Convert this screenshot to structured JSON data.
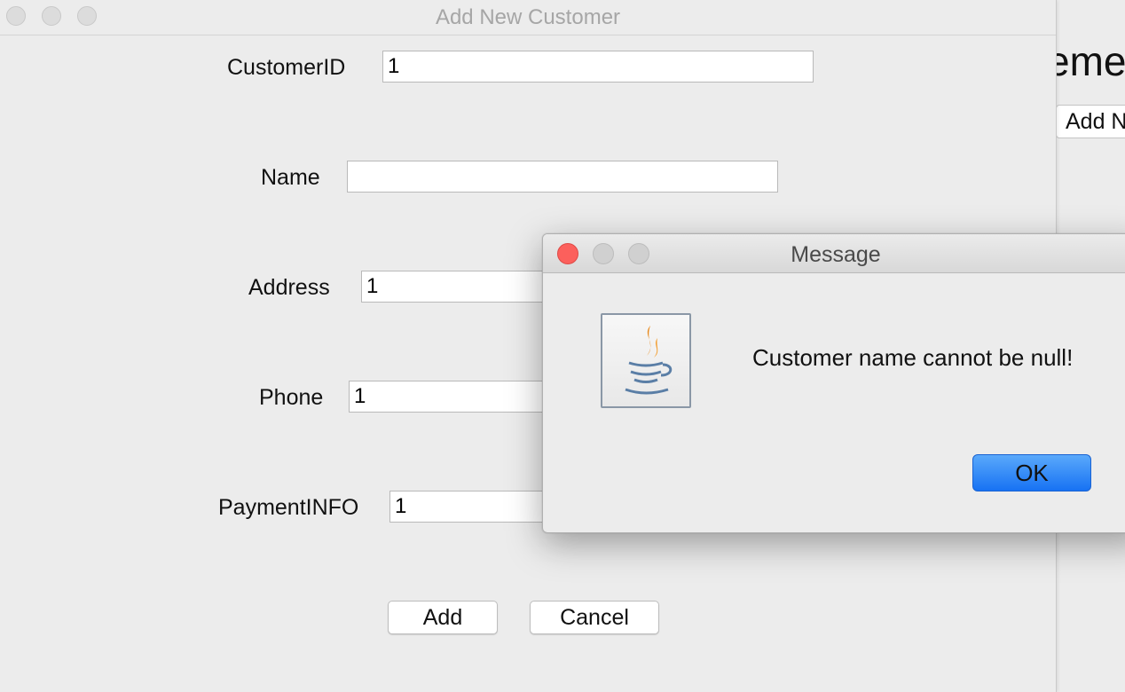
{
  "background_window": {
    "heading_fragment": "eme",
    "button_fragment": "Add N"
  },
  "add_customer_window": {
    "title": "Add New Customer",
    "fields": {
      "customer_id": {
        "label": "CustomerID",
        "value": "1"
      },
      "name": {
        "label": "Name",
        "value": ""
      },
      "address": {
        "label": "Address",
        "value": "1"
      },
      "phone": {
        "label": "Phone",
        "value": "1"
      },
      "payment_info": {
        "label": "PaymentINFO",
        "value": "1"
      }
    },
    "buttons": {
      "add": "Add",
      "cancel": "Cancel"
    }
  },
  "message_dialog": {
    "title": "Message",
    "icon": "java-coffee-cup-icon",
    "text": "Customer name cannot be null!",
    "ok": "OK"
  },
  "colors": {
    "window_bg": "#ececec",
    "close_red": "#fc605c",
    "ok_blue": "#1772f3",
    "java_orange": "#e8891c",
    "java_blue": "#5a7ea6"
  }
}
